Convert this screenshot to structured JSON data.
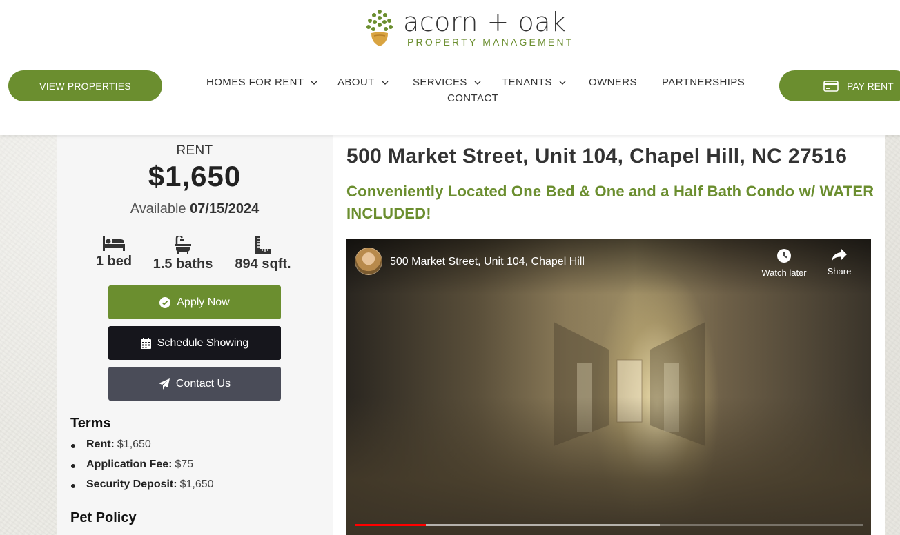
{
  "colors": {
    "brand_green": "#6b8e2f",
    "dark_button": "#16161c",
    "gray_button": "#4a4c58"
  },
  "header": {
    "logo": {
      "brand": "acorn + oak",
      "tagline": "PROPERTY MANAGEMENT",
      "icon": "acorn-icon"
    },
    "view_properties": "VIEW PROPERTIES",
    "pay_rent": "PAY RENT",
    "nav": [
      {
        "label": "HOMES FOR RENT",
        "dropdown": true
      },
      {
        "label": "ABOUT",
        "dropdown": true
      },
      {
        "label": "SERVICES",
        "dropdown": true
      },
      {
        "label": "TENANTS",
        "dropdown": true
      },
      {
        "label": "OWNERS",
        "dropdown": false
      },
      {
        "label": "PARTNERSHIPS",
        "dropdown": false
      },
      {
        "label": "CONTACT",
        "dropdown": false
      }
    ]
  },
  "listing": {
    "rent_label": "RENT",
    "rent_amount": "$1,650",
    "available_label": "Available",
    "available_date": "07/15/2024",
    "stats": [
      {
        "icon": "bed-icon",
        "value": "1 bed"
      },
      {
        "icon": "bath-icon",
        "value": "1.5 baths"
      },
      {
        "icon": "ruler-icon",
        "value": "894 sqft."
      }
    ],
    "actions": {
      "apply": "Apply Now",
      "schedule": "Schedule Showing",
      "contact": "Contact Us"
    },
    "terms_heading": "Terms",
    "terms": [
      {
        "label": "Rent:",
        "value": "$1,650"
      },
      {
        "label": "Application Fee:",
        "value": "$75"
      },
      {
        "label": "Security Deposit:",
        "value": "$1,650"
      }
    ],
    "pet_heading": "Pet Policy",
    "address": "500 Market Street, Unit 104, Chapel Hill, NC 27516",
    "headline": "Conveniently Located One Bed & One and a Half Bath Condo w/ WATER INCLUDED!"
  },
  "video": {
    "title": "500 Market Street, Unit 104, Chapel Hill",
    "watch_later": "Watch later",
    "share": "Share",
    "progress_fraction": 0.14,
    "buffered_fraction": 0.6
  }
}
